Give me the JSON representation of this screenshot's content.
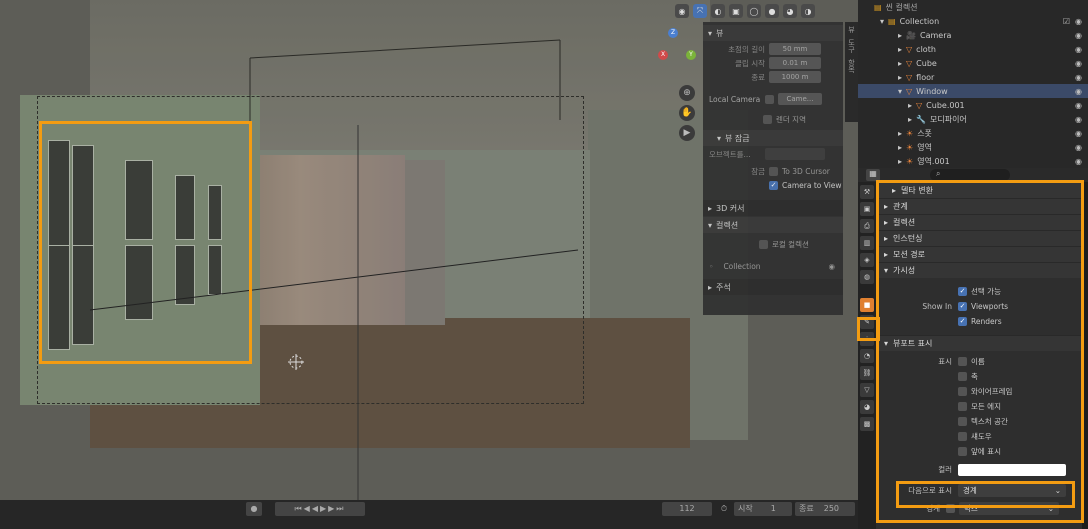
{
  "npanel": {
    "view_section": "뷰",
    "focal_label": "초점의 길이",
    "focal_value": "50 mm",
    "clip_start_label": "클립 시작",
    "clip_start_value": "0.01 m",
    "clip_end_label": "종료",
    "clip_end_value": "1000 m",
    "local_camera_label": "Local Camera",
    "local_camera_value": "Came...",
    "render_region": "렌더 지역",
    "view_lock_section": "뷰 잠금",
    "lock_object_label": "오브젝트를...",
    "lock_label": "잠금",
    "to_3d_cursor": "To 3D Cursor",
    "camera_to_view": "Camera to View",
    "cursor_section": "3D 커서",
    "collection_section": "컬렉션",
    "local_collection": "로컬 컬렉션",
    "collection_item": "Collection",
    "annotation_section": "주석"
  },
  "side_tabs": [
    "뷰",
    "도구",
    "항목"
  ],
  "timeline": {
    "current_frame": "112",
    "start_label": "시작",
    "start_value": "1",
    "end_label": "종료",
    "end_value": "250"
  },
  "outliner": {
    "title": "씬 컬렉션",
    "collection": "Collection",
    "items": [
      {
        "name": "Camera",
        "indent": 1,
        "kind": "camera",
        "selected": false
      },
      {
        "name": "cloth",
        "indent": 1,
        "kind": "mesh",
        "selected": false
      },
      {
        "name": "Cube",
        "indent": 1,
        "kind": "mesh",
        "selected": false
      },
      {
        "name": "floor",
        "indent": 1,
        "kind": "mesh",
        "selected": false
      },
      {
        "name": "Window",
        "indent": 1,
        "kind": "mesh",
        "selected": true
      },
      {
        "name": "Cube.001",
        "indent": 2,
        "kind": "mesh",
        "selected": false
      },
      {
        "name": "모디파이어",
        "indent": 2,
        "kind": "modifier",
        "selected": false
      },
      {
        "name": "스폿",
        "indent": 1,
        "kind": "light",
        "selected": false
      },
      {
        "name": "영역",
        "indent": 1,
        "kind": "light",
        "selected": false
      },
      {
        "name": "영역.001",
        "indent": 1,
        "kind": "light",
        "selected": false
      }
    ]
  },
  "props": {
    "delta_transform": "델타 변환",
    "relations": "관계",
    "collections": "컬렉션",
    "instancing": "인스턴싱",
    "motion_paths": "모션 경로",
    "visibility": "가시성",
    "selectable": "선택 가능",
    "show_in_label": "Show In",
    "viewports": "Viewports",
    "renders": "Renders",
    "viewport_display": "뷰포트 표시",
    "show_label": "표시",
    "name": "이름",
    "axis": "축",
    "wireframe": "와이어프레임",
    "all_edges": "모든 에지",
    "texture_space": "텍스처 공간",
    "shadow": "섀도우",
    "in_front": "앞에 표시",
    "color_label": "컬러",
    "display_as_label": "다음으로 표시",
    "display_as_value": "경계",
    "bounds_label": "경계",
    "bounds_value": "박스"
  },
  "colors": {
    "highlight": "#f39c12",
    "accent_blue": "#4772b3",
    "active_tab": "#e08030",
    "selected_row": "#3b4a68"
  }
}
